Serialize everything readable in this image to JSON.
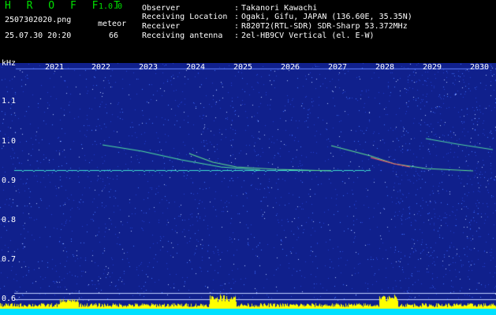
{
  "header": {
    "app_name": "H R O F F T",
    "version": "1.0.0",
    "filename": "2507302020.png",
    "datetime": "25.07.30 20:20",
    "meteor_label": "meteor",
    "meteor_count": "66"
  },
  "info": [
    {
      "label": "Observer",
      "value": "Takanori Kawachi"
    },
    {
      "label": "Receiving Location",
      "value": "Ogaki, Gifu, JAPAN (136.60E, 35.35N)"
    },
    {
      "label": "Receiver",
      "value": "R820T2(RTL-SDR) SDR-Sharp 53.372MHz"
    },
    {
      "label": "Receiving antenna",
      "value": "2el-HB9CV Vertical (el. E-W)"
    }
  ],
  "separator": ":",
  "axis": {
    "unit": "kHz",
    "freq_labels": [
      "1.1",
      "1.0",
      "0.9",
      "0.8",
      "0.7",
      "0.6"
    ],
    "time_labels": [
      "2021",
      "2022",
      "2023",
      "2024",
      "2025",
      "2026",
      "2027",
      "2028",
      "2029",
      "2030"
    ]
  },
  "colors": {
    "background": "#10208c",
    "header_text": "#ffffff",
    "brand": "#00e000",
    "baseline": "#00e0ff",
    "spikes": "#ffff00"
  }
}
